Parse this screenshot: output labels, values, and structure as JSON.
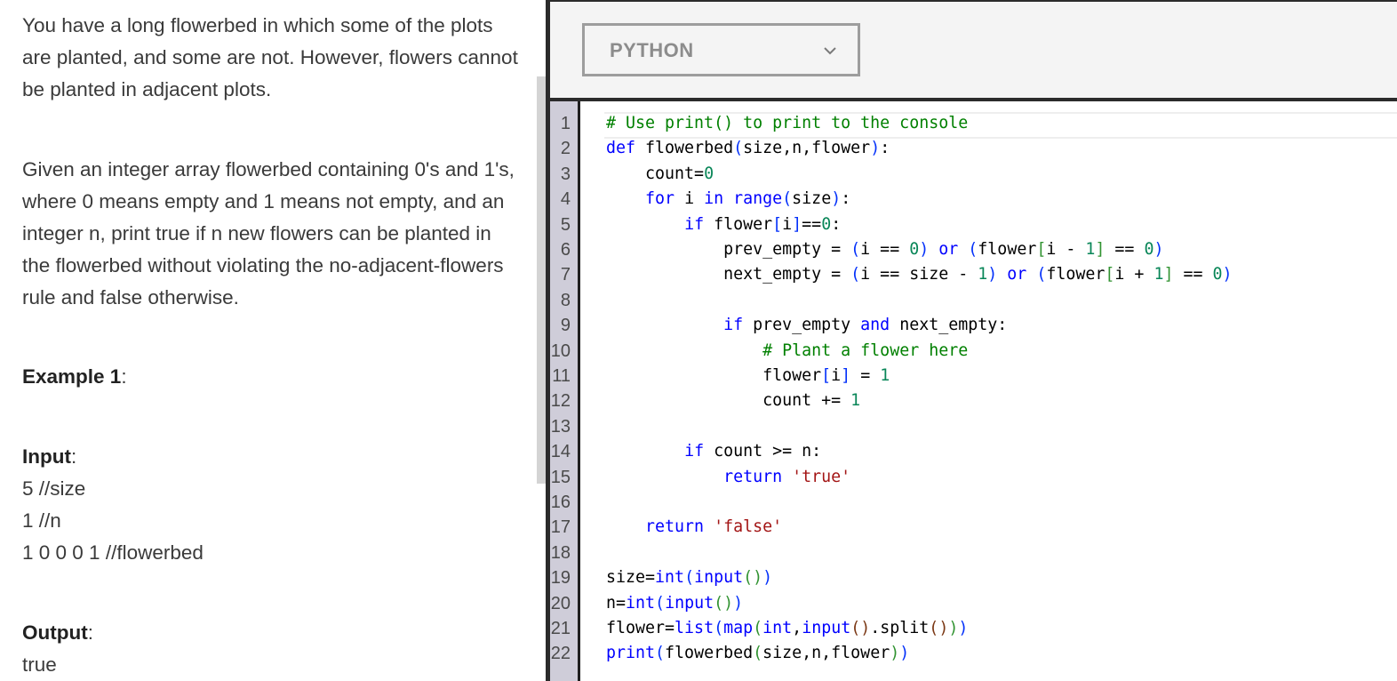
{
  "problem": {
    "paragraph1": "You have a long flowerbed in which some of the plots are planted, and some are not. However, flowers cannot be planted in adjacent plots.",
    "paragraph2": "Given an integer array flowerbed containing 0's and 1's, where 0 means empty and 1 means not empty, and an integer n, print true if n new flowers can be planted in the flowerbed without violating the no-adjacent-flowers rule and false otherwise.",
    "example_label": "Example 1",
    "input_label": "Input",
    "colon": ":",
    "input_lines": [
      "5 //size",
      "1 //n",
      "1 0 0 0 1 //flowerbed"
    ],
    "output_label": "Output",
    "output_value": "true"
  },
  "editor": {
    "language": "PYTHON",
    "line_numbers": [
      "1",
      "2",
      "3",
      "4",
      "5",
      "6",
      "7",
      "8",
      "9",
      "10",
      "11",
      "12",
      "13",
      "14",
      "15",
      "16",
      "17",
      "18",
      "19",
      "20",
      "21",
      "22"
    ],
    "code_lines": [
      "# Use print() to print to the console",
      "def flowerbed(size,n,flower):",
      "    count=0",
      "    for i in range(size):",
      "        if flower[i]==0:",
      "            prev_empty = (i == 0) or (flower[i - 1] == 0)",
      "            next_empty = (i == size - 1) or (flower[i + 1] == 0)",
      "",
      "            if prev_empty and next_empty:",
      "                # Plant a flower here",
      "                flower[i] = 1",
      "                count += 1",
      "",
      "        if count >= n:",
      "            return 'true'",
      "",
      "    return 'false'",
      "",
      "size=int(input())",
      "n=int(input())",
      "flower=list(map(int,input().split()))",
      "print(flowerbed(size,n,flower))"
    ]
  },
  "colors": {
    "keyword": "#0000ff",
    "comment": "#008000",
    "number": "#098658",
    "string": "#a31515"
  }
}
